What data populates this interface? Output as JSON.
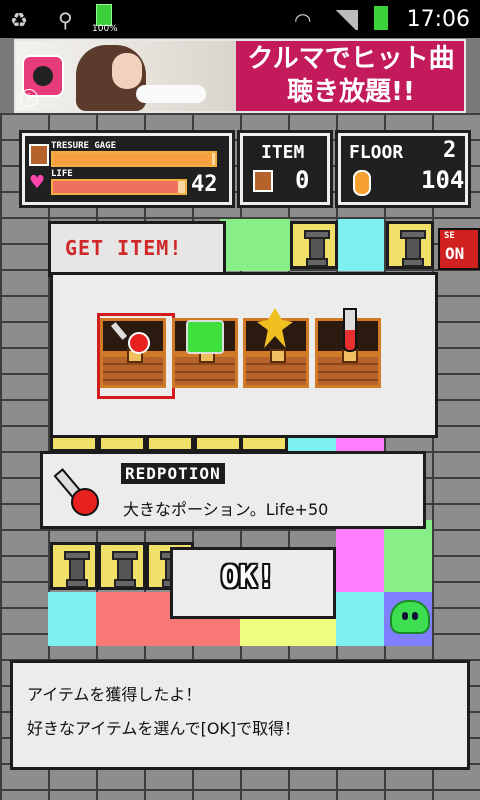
{
  "status_bar": {
    "time": "17:06",
    "battery_percent_label": "100%",
    "icons": [
      "recycle-icon",
      "usb-icon",
      "battery-icon",
      "wifi-icon",
      "signal-icon",
      "battery-icon"
    ]
  },
  "ad": {
    "headline_line1": "クルマでヒット曲",
    "headline_line2": "聴き放題!!",
    "info_label": "i"
  },
  "hud": {
    "treasure_gage_label": "TRESURE GAGE",
    "life_label": "LIFE",
    "life_value": "42",
    "treasure_gage_fraction": 0.98,
    "life_fraction": 0.95,
    "item_label": "ITEM",
    "item_count": "0",
    "floor_label": "FLOOR",
    "floor_value": "2",
    "coin_count": "104"
  },
  "se_toggle": {
    "label_top": "SE",
    "label": "ON"
  },
  "get_item": {
    "title": "GET ITEM!",
    "chests": [
      {
        "item_icon": "red-potion-icon",
        "selected": true
      },
      {
        "item_icon": "green-potion-icon",
        "selected": false
      },
      {
        "item_icon": "yellow-crystal-icon",
        "selected": false
      },
      {
        "item_icon": "test-tube-icon",
        "selected": false
      }
    ]
  },
  "description": {
    "name": "REDPOTION",
    "text": "大きなポーション。Life+50"
  },
  "ok_button": {
    "label": "OK!"
  },
  "message": {
    "line1": "アイテムを獲得したよ！",
    "line2": "好きなアイテムを選んで[OK]で取得！"
  },
  "colors": {
    "chest_border": "#d07a28",
    "selection": "#d01c1c",
    "panel_bg": "#ececec",
    "hud_bg": "#202020",
    "tile_yellow": "#f0e06a",
    "tile_cyan": "#7ff0f0",
    "tile_green": "#88ee88",
    "tile_pink": "#ff7fff",
    "tile_red": "#f87878",
    "tile_lime": "#eeff80"
  }
}
